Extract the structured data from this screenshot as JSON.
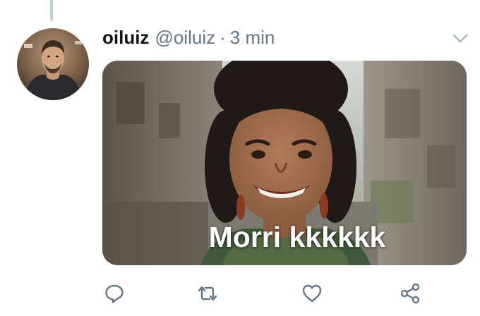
{
  "tweet": {
    "display_name": "oiluiz",
    "handle": "@oiluiz",
    "separator": "·",
    "time": "3 min",
    "image_caption": "Morri kkkkkk"
  },
  "icons": {
    "caret": "chevron-down-icon",
    "reply": "reply-icon",
    "retweet": "retweet-icon",
    "like": "heart-icon",
    "share": "share-icon"
  },
  "colors": {
    "name": "#14171a",
    "secondary": "#657786",
    "action_icon": "#657786",
    "caret": "#aab8c2",
    "thread_line": "#c4cfd6"
  }
}
